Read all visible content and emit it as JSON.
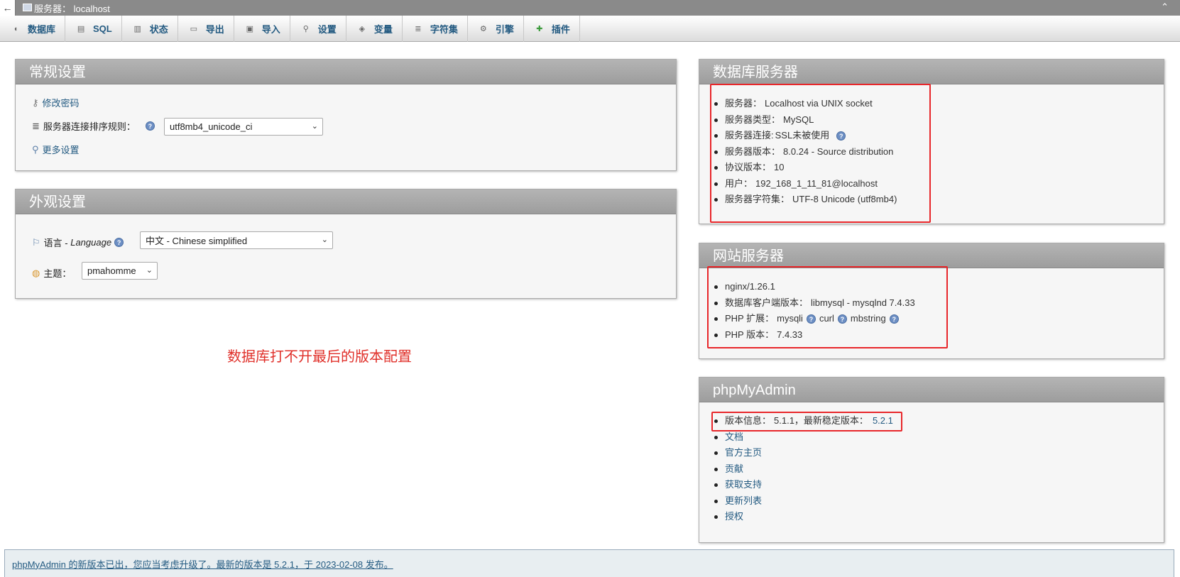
{
  "topbar": {
    "back": "←",
    "server_label": "服务器：  localhost",
    "collapse": "⌃"
  },
  "nav": [
    {
      "label": "数据库",
      "icon": "database-icon",
      "glyph": "◖"
    },
    {
      "label": "SQL",
      "icon": "sql-icon",
      "glyph": "▤"
    },
    {
      "label": "状态",
      "icon": "status-icon",
      "glyph": "▥"
    },
    {
      "label": "导出",
      "icon": "export-icon",
      "glyph": "▭"
    },
    {
      "label": "导入",
      "icon": "import-icon",
      "glyph": "▣"
    },
    {
      "label": "设置",
      "icon": "wrench-icon",
      "glyph": "⚲"
    },
    {
      "label": "变量",
      "icon": "variables-icon",
      "glyph": "◈"
    },
    {
      "label": "字符集",
      "icon": "charset-icon",
      "glyph": "≣"
    },
    {
      "label": "引擎",
      "icon": "engine-icon",
      "glyph": "⚙"
    },
    {
      "label": "插件",
      "icon": "plugin-icon",
      "glyph": "✚"
    }
  ],
  "general": {
    "title": "常规设置",
    "change_password": "修改密码",
    "collation_label": "服务器连接排序规则：",
    "collation_value": "utf8mb4_unicode_ci",
    "more_settings": "更多设置"
  },
  "appearance": {
    "title": "外观设置",
    "language_label": "语言 - ",
    "language_label_en": "Language",
    "language_value": "中文 - Chinese simplified",
    "theme_label": "主题：",
    "theme_value": "pmahomme"
  },
  "annotation": "数据库打不开最后的版本配置",
  "db_server": {
    "title": "数据库服务器",
    "items": [
      {
        "label": "服务器：",
        "value": "Localhost via UNIX socket"
      },
      {
        "label": "服务器类型：",
        "value": "MySQL"
      },
      {
        "label": "服务器连接:",
        "value": "SSL未被使用"
      },
      {
        "label": "服务器版本：",
        "value": "8.0.24 - Source distribution"
      },
      {
        "label": "协议版本：",
        "value": "10"
      },
      {
        "label": "用户：",
        "value": "192_168_1_11_81@localhost"
      },
      {
        "label": "服务器字符集：",
        "value": "UTF-8 Unicode (utf8mb4)"
      }
    ]
  },
  "web_server": {
    "title": "网站服务器",
    "items": [
      {
        "label": "nginx/1.26.1",
        "value": ""
      },
      {
        "label": "数据库客户端版本：",
        "value": "libmysql - mysqlnd 7.4.33"
      },
      {
        "label": "PHP 扩展：",
        "value": "mysqli",
        "ext2": "curl",
        "ext3": "mbstring"
      },
      {
        "label": "PHP 版本：",
        "value": "7.4.33"
      }
    ]
  },
  "pma": {
    "title": "phpMyAdmin",
    "version_label": "版本信息：",
    "version_value": "5.1.1，最新稳定版本：",
    "latest": "5.2.1",
    "links": [
      "文档",
      "官方主页",
      "贡献",
      "获取支持",
      "更新列表",
      "授权"
    ]
  },
  "notice": "phpMyAdmin 的新版本已出，您应当考虑升级了。最新的版本是 5.2.1，于 2023-02-08 发布。",
  "hint_glyph": "?",
  "caret": "⌄"
}
